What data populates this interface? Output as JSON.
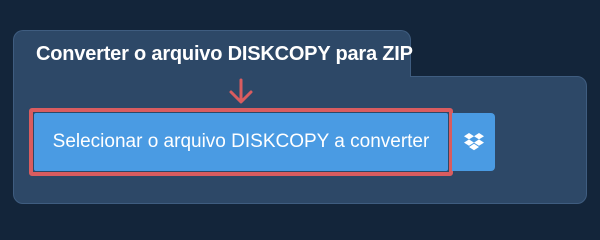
{
  "panel": {
    "title": "Converter o arquivo DISKCOPY para ZIP"
  },
  "actions": {
    "select_file_label": "Selecionar o arquivo DISKCOPY a converter",
    "dropbox_icon": "dropbox-icon"
  },
  "colors": {
    "page_background": "#13253a",
    "panel_background": "#2d4867",
    "button_blue": "#4a9be3",
    "highlight_red": "#d95c5f"
  }
}
